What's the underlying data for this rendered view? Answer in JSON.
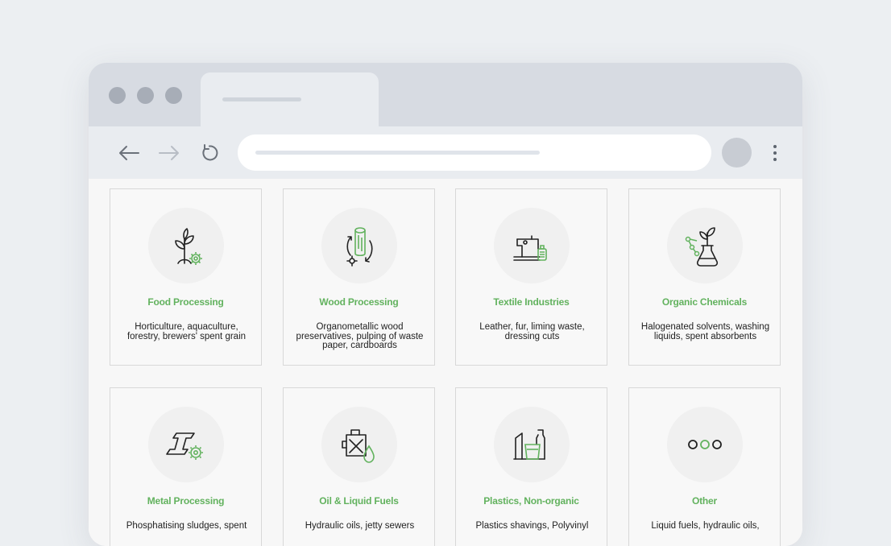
{
  "browser": {
    "controls": [
      "close",
      "minimize",
      "maximize"
    ],
    "tab_title": "",
    "address": "",
    "nav": {
      "back_icon": "arrow-left-icon",
      "forward_icon": "arrow-right-icon",
      "reload_icon": "reload-icon"
    }
  },
  "categories": [
    {
      "title": "Food Processing",
      "description": "Horticulture, aquaculture, forestry, brewers' spent grain",
      "icon": "plant-gear-icon"
    },
    {
      "title": "Wood Processing",
      "description": "Organometallic wood preservatives, pulping of waste paper, cardboards",
      "icon": "log-recycle-icon"
    },
    {
      "title": "Textile Industries",
      "description": "Leather, fur, liming waste, dressing cuts",
      "icon": "sewing-machine-icon"
    },
    {
      "title": "Organic Chemicals",
      "description": "Halogenated solvents, washing liquids, spent absorbents",
      "icon": "flask-plant-icon"
    },
    {
      "title": "Metal Processing",
      "description": "Phosphatising sludges, spent",
      "icon": "metal-beam-gear-icon"
    },
    {
      "title": "Oil & Liquid Fuels",
      "description": "Hydraulic oils, jetty sewers",
      "icon": "jerrycan-drop-icon"
    },
    {
      "title": "Plastics, Non-organic",
      "description": "Plastics shavings, Polyvinyl",
      "icon": "plastic-bottles-icon"
    },
    {
      "title": "Other",
      "description": "Liquid fuels, hydraulic oils,",
      "icon": "three-dots-icon"
    }
  ],
  "colors": {
    "accent": "#62b25e",
    "icon_stroke": "#222222",
    "window_chrome": "#d7dbe2",
    "toolbar": "#e9ecf0"
  }
}
